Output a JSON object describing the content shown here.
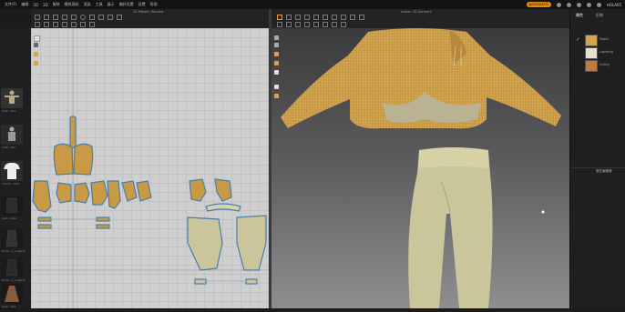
{
  "menu": [
    "文件(F)",
    "编辑",
    "2D",
    "3D",
    "服装",
    "模拟面料",
    "渲染",
    "工具",
    "展示",
    "偏好设置",
    "设置",
    "帮助"
  ],
  "account": {
    "label": "personal 6",
    "user": "HOLA05"
  },
  "panels": {
    "pattern_title": "2D Pattern Window",
    "viewport_title": "Avatar 3D Garment",
    "right_tabs": [
      "属性",
      "织物"
    ],
    "right_header": "属性编辑器"
  },
  "library": [
    {
      "name": "Fabric",
      "swatch": "#d3a64c"
    },
    {
      "name": "Lapeling",
      "swatch": "#e4e0d0"
    },
    {
      "name": "Lining",
      "swatch": "#c07a3a"
    }
  ],
  "left_thumbs": [
    {
      "caption": "Avat...e01",
      "color": "#b8a888"
    },
    {
      "caption": "avat...s02",
      "color": "#9a9a9a"
    },
    {
      "caption": "T-Shirt...m01",
      "color": "#e8e8e8"
    },
    {
      "caption": "Avat...tops",
      "color": "#2a2a2a"
    },
    {
      "caption": "Hood...s_cropped",
      "color": "#333333"
    },
    {
      "caption": "Hood...s_cropped",
      "color": "#2a2a2a"
    },
    {
      "caption": "Avat...e02",
      "color": "#8a5a3a"
    }
  ],
  "colors": {
    "accent": "#f0a020",
    "jacket": "#c99a45",
    "pants": "#cac59a",
    "pattern_bg": "#cfcfd0"
  }
}
